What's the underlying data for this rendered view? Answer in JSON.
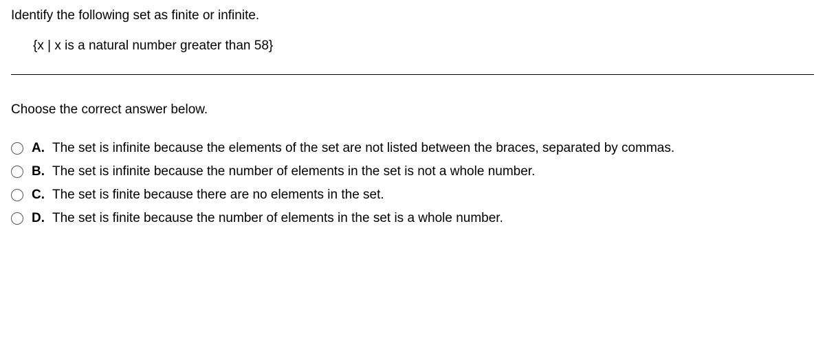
{
  "question": {
    "prompt": "Identify the following set as finite or infinite.",
    "set": "{x | x is a natural number greater than 58}"
  },
  "instruction": "Choose the correct answer below.",
  "options": {
    "a": {
      "letter": "A.",
      "text": "The set is infinite because the elements of the set are not listed between the braces, separated by commas."
    },
    "b": {
      "letter": "B.",
      "text": "The set is infinite because the number of elements in the set is not a whole number."
    },
    "c": {
      "letter": "C.",
      "text": "The set is finite because there are no elements in the set."
    },
    "d": {
      "letter": "D.",
      "text": "The set is finite because the number of elements in the set is a whole number."
    }
  }
}
